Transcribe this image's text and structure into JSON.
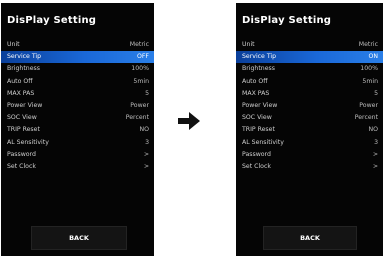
{
  "before": {
    "title": "DisPlay Setting",
    "rows": [
      {
        "label": "Unit",
        "value": "Metric"
      },
      {
        "label": "Service Tip",
        "value": "OFF"
      },
      {
        "label": "Brightness",
        "value": "100%"
      },
      {
        "label": "Auto Off",
        "value": "5min"
      },
      {
        "label": "MAX PAS",
        "value": "5"
      },
      {
        "label": "Power View",
        "value": "Power"
      },
      {
        "label": "SOC View",
        "value": "Percent"
      },
      {
        "label": "TRIP Reset",
        "value": "NO"
      },
      {
        "label": "AL Sensitivity",
        "value": "3"
      },
      {
        "label": "Password",
        "value": ">"
      },
      {
        "label": "Set Clock",
        "value": ">"
      }
    ],
    "back_label": "BACK"
  },
  "after": {
    "title": "DisPlay Setting",
    "rows": [
      {
        "label": "Unit",
        "value": "Metric"
      },
      {
        "label": "Service Tip",
        "value": "ON"
      },
      {
        "label": "Brightness",
        "value": "100%"
      },
      {
        "label": "Auto Off",
        "value": "5min"
      },
      {
        "label": "MAX PAS",
        "value": "5"
      },
      {
        "label": "Power View",
        "value": "Power"
      },
      {
        "label": "SOC View",
        "value": "Percent"
      },
      {
        "label": "TRIP Reset",
        "value": "NO"
      },
      {
        "label": "AL Sensitivity",
        "value": "3"
      },
      {
        "label": "Password",
        "value": ">"
      },
      {
        "label": "Set Clock",
        "value": ">"
      }
    ],
    "back_label": "BACK"
  },
  "selected_row_index": 1,
  "arrow_icon": "right-arrow-icon",
  "colors": {
    "screen_bg": "#050505",
    "highlight": "#1a68d8",
    "text": "#cfcfcf"
  }
}
